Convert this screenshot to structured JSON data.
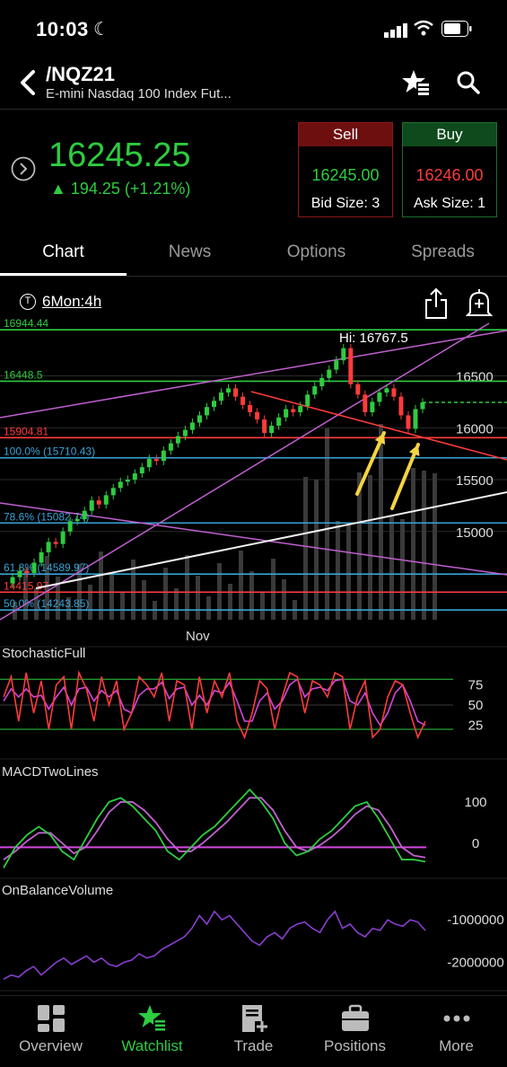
{
  "status": {
    "time": "10:03"
  },
  "nav": {
    "symbol": "/NQZ21",
    "subtitle": "E-mini Nasdaq 100 Index Fut..."
  },
  "quote": {
    "price": "16245.25",
    "change": "▲ 194.25 (+1.21%)",
    "sell": {
      "label": "Sell",
      "price": "16245.00",
      "size": "Bid Size: 3"
    },
    "buy": {
      "label": "Buy",
      "price": "16246.00",
      "size": "Ask Size: 1"
    }
  },
  "tabs": [
    "Chart",
    "News",
    "Options",
    "Spreads"
  ],
  "timeframe": {
    "label": "6Mon:4h",
    "icon": "T"
  },
  "colors": {
    "green": "#2ecc40",
    "red": "#ff3b3b",
    "purple": "#c060d0",
    "blue": "#39a3d6"
  },
  "chart_data": [
    {
      "type": "line",
      "name": "price",
      "hi_label": "Hi: 16767.5",
      "price_axis": [
        "16500",
        "16000",
        "15500",
        "15000"
      ],
      "x_label": "Nov",
      "levels": [
        {
          "label": "16944.44",
          "value": 16944.44,
          "color": "#2ecc40"
        },
        {
          "label": "16448.5",
          "value": 16448.5,
          "color": "#2ecc40"
        },
        {
          "label": "15904.81",
          "value": 15904.81,
          "color": "#ff3b3b"
        },
        {
          "label": "100.0% (15710.43)",
          "value": 15710.43,
          "color": "#39a3d6"
        },
        {
          "label": "78.6% (15082.74)",
          "value": 15082.74,
          "color": "#39a3d6"
        },
        {
          "label": "61.8% (14589.97)",
          "value": 14589.97,
          "color": "#39a3d6"
        },
        {
          "label": "14415.97",
          "value": 14415.97,
          "color": "#ff3b3b"
        },
        {
          "label": "50.0% (14243.85)",
          "value": 14243.85,
          "color": "#39a3d6"
        }
      ],
      "close": [
        14500,
        14560,
        14620,
        14600,
        14700,
        14800,
        14900,
        14880,
        15000,
        15100,
        15120,
        15200,
        15300,
        15260,
        15350,
        15420,
        15480,
        15500,
        15560,
        15620,
        15700,
        15680,
        15780,
        15850,
        15920,
        15980,
        16050,
        16120,
        16200,
        16260,
        16340,
        16380,
        16300,
        16220,
        16150,
        16080,
        15950,
        16020,
        16100,
        16180,
        16150,
        16210,
        16320,
        16400,
        16480,
        16560,
        16650,
        16767,
        16420,
        16320,
        16150,
        16250,
        16340,
        16380,
        16300,
        16120,
        15990,
        16180,
        16245
      ]
    },
    {
      "type": "line",
      "name": "StochasticFull",
      "title": "StochasticFull",
      "ticks": [
        "75",
        "50",
        "25"
      ],
      "k": [
        60,
        85,
        30,
        90,
        40,
        80,
        20,
        75,
        85,
        20,
        90,
        70,
        30,
        85,
        50,
        80,
        20,
        40,
        85,
        75,
        60,
        90,
        30,
        80,
        75,
        20,
        85,
        40,
        80,
        60,
        90,
        30,
        10,
        40,
        80,
        70,
        20,
        60,
        90,
        85,
        40,
        80,
        75,
        60,
        90,
        85,
        20,
        60,
        80,
        10,
        20,
        60,
        80,
        75,
        40,
        10,
        30
      ],
      "d": [
        55,
        70,
        60,
        70,
        60,
        62,
        45,
        60,
        72,
        50,
        70,
        72,
        55,
        68,
        60,
        68,
        45,
        40,
        62,
        70,
        70,
        78,
        58,
        70,
        72,
        50,
        62,
        50,
        68,
        65,
        78,
        55,
        30,
        30,
        55,
        65,
        45,
        55,
        75,
        82,
        60,
        70,
        72,
        68,
        80,
        82,
        55,
        50,
        65,
        40,
        25,
        40,
        65,
        75,
        55,
        30,
        25
      ]
    },
    {
      "type": "line",
      "name": "MACDTwoLines",
      "title": "MACDTwoLines",
      "ticks": [
        "100",
        "0"
      ],
      "macd": [
        -60,
        -10,
        20,
        40,
        20,
        -20,
        -40,
        10,
        60,
        100,
        110,
        90,
        60,
        30,
        -20,
        -40,
        -10,
        20,
        40,
        70,
        100,
        130,
        100,
        60,
        0,
        -30,
        -20,
        10,
        30,
        60,
        90,
        100,
        60,
        10,
        -40,
        -40,
        -45
      ],
      "signal": [
        -40,
        -20,
        5,
        25,
        25,
        0,
        -25,
        -10,
        30,
        75,
        100,
        100,
        80,
        50,
        10,
        -20,
        -20,
        0,
        25,
        50,
        80,
        110,
        110,
        80,
        30,
        -10,
        -20,
        -5,
        15,
        40,
        70,
        90,
        80,
        40,
        -10,
        -30,
        -35
      ]
    },
    {
      "type": "line",
      "name": "OnBalanceVolume",
      "title": "OnBalanceVolume",
      "ticks": [
        "-1000000",
        "-2000000"
      ],
      "obv": [
        -2400000,
        -2300000,
        -2350000,
        -2200000,
        -2100000,
        -2300000,
        -2150000,
        -2000000,
        -1900000,
        -2050000,
        -1950000,
        -1850000,
        -2000000,
        -1900000,
        -2050000,
        -2100000,
        -2000000,
        -1950000,
        -1800000,
        -1900000,
        -1850000,
        -1700000,
        -1600000,
        -1500000,
        -1400000,
        -1200000,
        -900000,
        -1100000,
        -800000,
        -1000000,
        -900000,
        -1100000,
        -1300000,
        -1500000,
        -1600000,
        -1400000,
        -1300000,
        -1450000,
        -1200000,
        -1100000,
        -1050000,
        -1200000,
        -1300000,
        -1000000,
        -800000,
        -1200000,
        -1100000,
        -1300000,
        -1400000,
        -1200000,
        -1250000,
        -1000000,
        -1100000,
        -1150000,
        -1000000,
        -1050000,
        -1250000
      ]
    }
  ],
  "bottom_nav": [
    {
      "label": "Overview",
      "icon": "grid-icon"
    },
    {
      "label": "Watchlist",
      "icon": "star-list-icon"
    },
    {
      "label": "Trade",
      "icon": "ticket-icon"
    },
    {
      "label": "Positions",
      "icon": "briefcase-icon"
    },
    {
      "label": "More",
      "icon": "dots-icon"
    }
  ]
}
